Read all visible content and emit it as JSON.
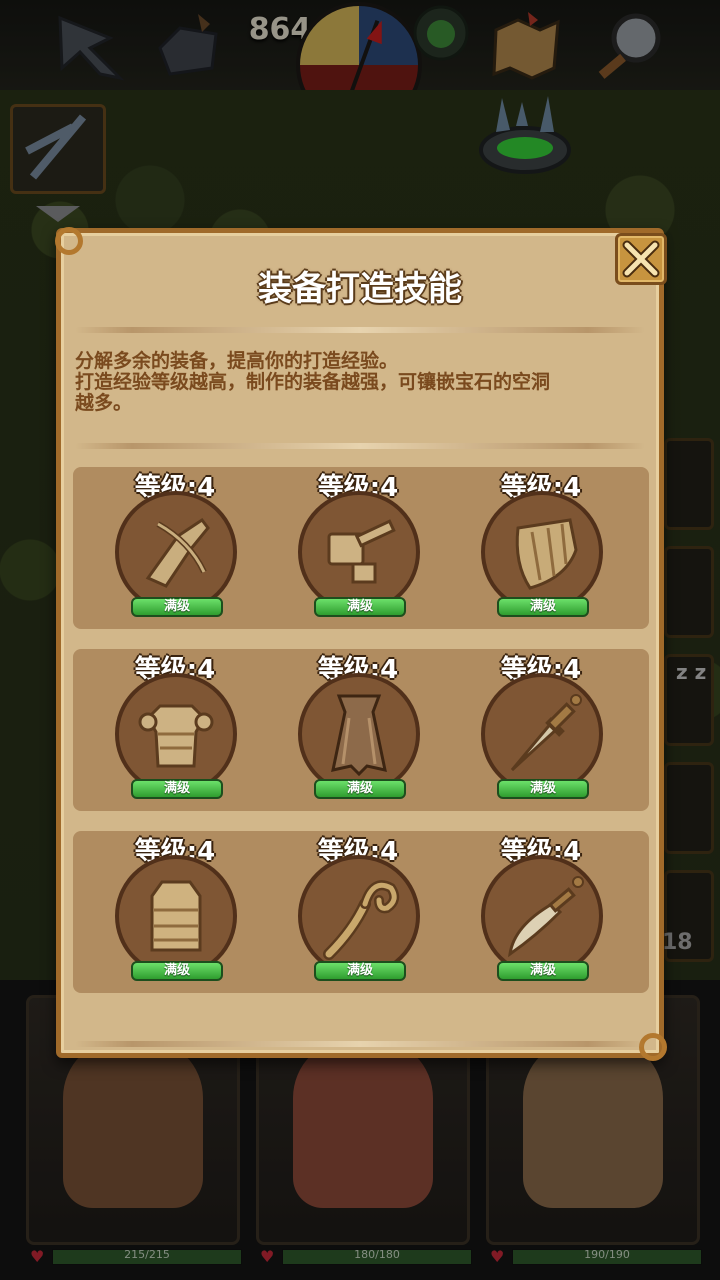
{
  "topbar": {
    "gold": "864"
  },
  "background": {
    "zz": "z z",
    "side_count": "18",
    "heroes": [
      {
        "hp": "215/215"
      },
      {
        "hp": "180/180"
      },
      {
        "hp": "190/190"
      }
    ]
  },
  "dialog": {
    "title": "装备打造技能",
    "desc_line1": "分解多余的装备，提高你的打造经验。",
    "desc_line2": "打造经验等级越高，制作的装备越强，可镶嵌宝石的空洞",
    "desc_line3": "越多。",
    "skills": [
      {
        "level": "等级:4",
        "status": "满级",
        "icon": "crossbow-icon"
      },
      {
        "level": "等级:4",
        "status": "满级",
        "icon": "hammer-icon"
      },
      {
        "level": "等级:4",
        "status": "满级",
        "icon": "shield-icon"
      },
      {
        "level": "等级:4",
        "status": "满级",
        "icon": "plate-armor-icon"
      },
      {
        "level": "等级:4",
        "status": "满级",
        "icon": "cloak-icon"
      },
      {
        "level": "等级:4",
        "status": "满级",
        "icon": "dagger-icon"
      },
      {
        "level": "等级:4",
        "status": "满级",
        "icon": "leather-armor-icon"
      },
      {
        "level": "等级:4",
        "status": "满级",
        "icon": "staff-icon"
      },
      {
        "level": "等级:4",
        "status": "满级",
        "icon": "scimitar-icon"
      }
    ]
  },
  "colors": {
    "panel": "#d2b78a",
    "border": "#a06a2a",
    "text_brown": "#7a4a1e",
    "max_green": "#3fae3c"
  }
}
